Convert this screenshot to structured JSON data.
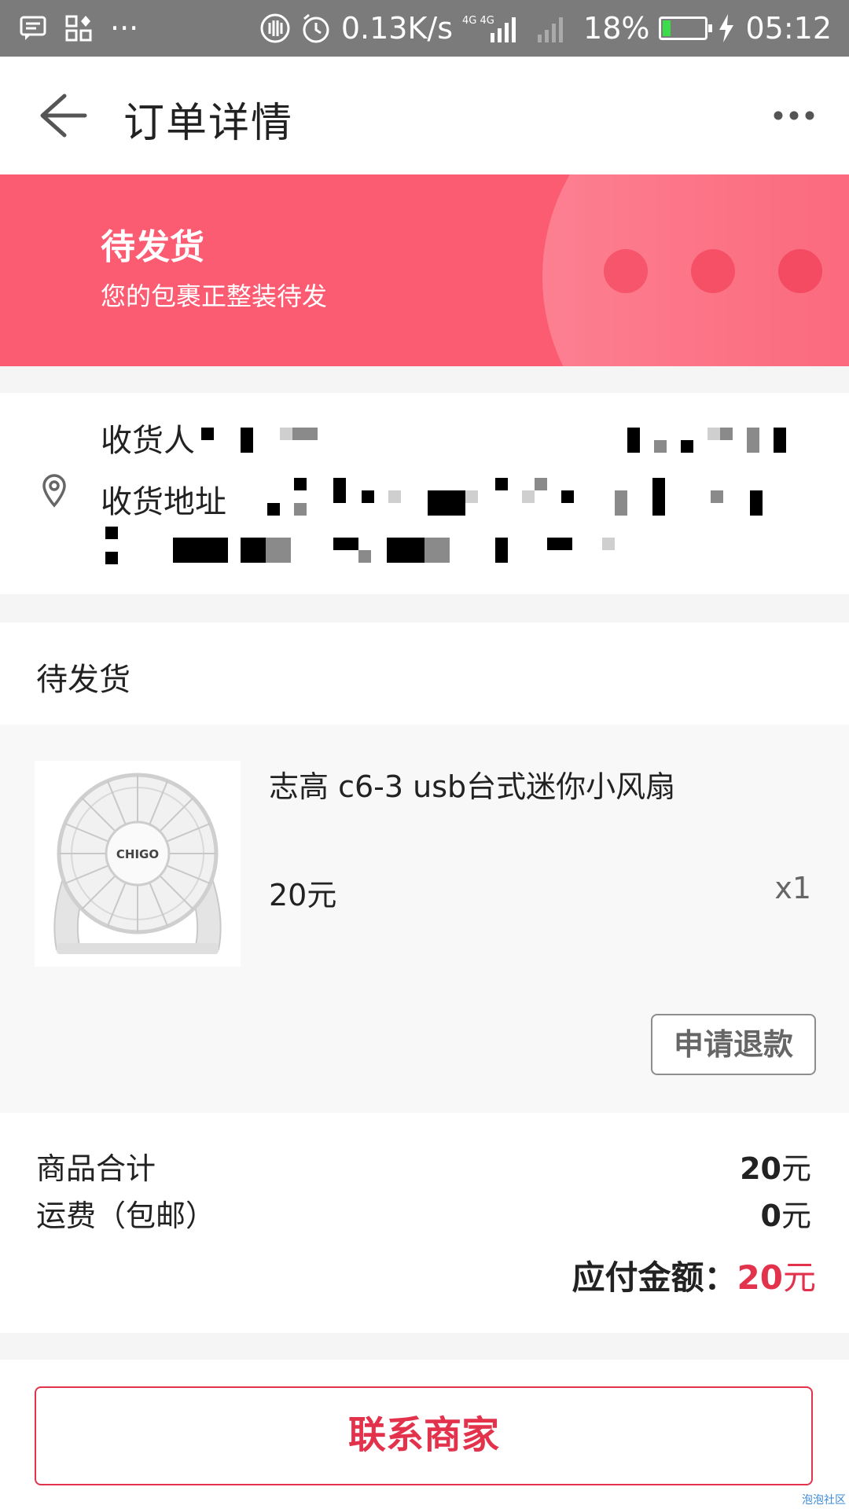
{
  "status_bar": {
    "network_speed": "0.13K/s",
    "signal1": "4G 4G",
    "battery": "18%",
    "battery_level": 0.18,
    "time": "05:12"
  },
  "header": {
    "title": "订单详情"
  },
  "banner": {
    "status": "待发货",
    "subtitle": "您的包裹正整装待发",
    "color": "#fb5c72"
  },
  "address": {
    "receiver_label": "收货人",
    "address_label": "收货地址"
  },
  "order": {
    "section_title": "待发货",
    "item": {
      "name": "志高 c6-3 usb台式迷你小风扇",
      "price": "20元",
      "quantity": "x1",
      "refund_label": "申请退款"
    }
  },
  "totals": {
    "subtotal_label": "商品合计",
    "subtotal_value": "20",
    "subtotal_unit": "元",
    "shipping_label": "运费（包邮）",
    "shipping_value": "0",
    "shipping_unit": "元",
    "due_label": "应付金额：",
    "due_value": "20",
    "due_unit": "元"
  },
  "actions": {
    "contact_label": "联系商家"
  },
  "watermark": "泡泡社区"
}
